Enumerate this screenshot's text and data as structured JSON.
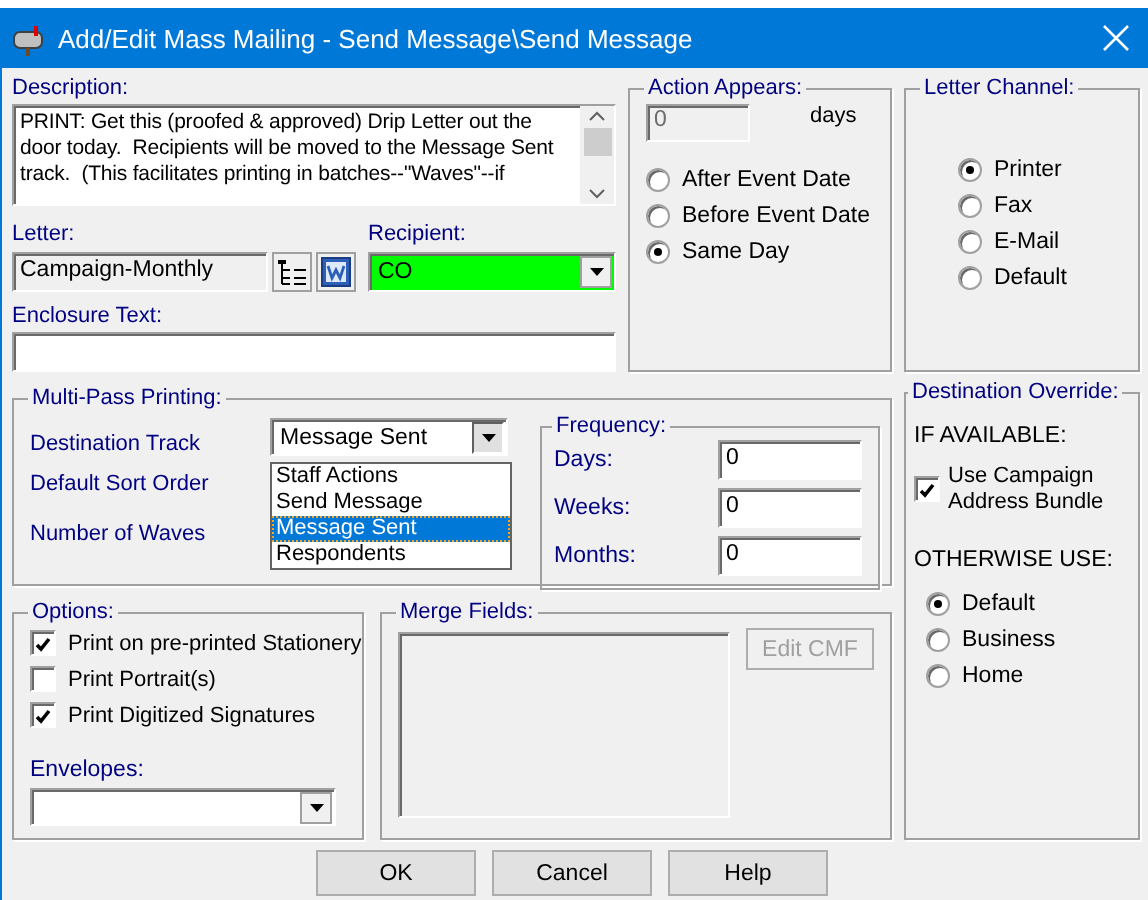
{
  "window": {
    "title": "Add/Edit Mass Mailing - Send Message\\Send Message"
  },
  "description": {
    "label": "Description:",
    "value": "PRINT: Get this (proofed & approved) Drip Letter out the door today.  Recipients will be moved to the Message Sent track.  (This facilitates printing in batches--\"Waves\"--if"
  },
  "letter": {
    "label": "Letter:",
    "value": "Campaign-Monthly"
  },
  "recipient": {
    "label": "Recipient:",
    "value": "CO"
  },
  "enclosure": {
    "label": "Enclosure Text:"
  },
  "action_appears": {
    "title": "Action Appears:",
    "days_value": "0",
    "days_disabled": true,
    "days_label": "days",
    "options": [
      {
        "label": "After Event Date",
        "selected": false
      },
      {
        "label": "Before Event Date",
        "selected": false
      },
      {
        "label": "Same Day",
        "selected": true
      }
    ]
  },
  "letter_channel": {
    "title": "Letter Channel:",
    "options": [
      {
        "label": "Printer",
        "selected": true
      },
      {
        "label": "Fax",
        "selected": false
      },
      {
        "label": "E-Mail",
        "selected": false
      },
      {
        "label": "Default",
        "selected": false
      }
    ]
  },
  "multi_pass": {
    "title": "Multi-Pass Printing:",
    "labels": [
      "Destination Track",
      "Default Sort Order",
      "Number of Waves"
    ],
    "destination_track": {
      "value": "Message Sent",
      "expanded": true,
      "options": [
        {
          "label": "Staff Actions",
          "selected": false
        },
        {
          "label": "Send Message",
          "selected": false
        },
        {
          "label": "Message Sent",
          "selected": true
        },
        {
          "label": "Respondents",
          "selected": false
        }
      ]
    },
    "frequency": {
      "title": "Frequency:",
      "fields": [
        {
          "label": "Days:",
          "value": "0"
        },
        {
          "label": "Weeks:",
          "value": "0"
        },
        {
          "label": "Months:",
          "value": "0"
        }
      ]
    }
  },
  "options": {
    "title": "Options:",
    "checks": [
      {
        "label": "Print on pre-printed Stationery",
        "checked": true
      },
      {
        "label": "Print Portrait(s)",
        "checked": false
      },
      {
        "label": "Print Digitized Signatures",
        "checked": true
      }
    ],
    "envelopes_label": "Envelopes:"
  },
  "merge_fields": {
    "title": "Merge Fields:",
    "button": {
      "label": "Edit CMF",
      "disabled": true
    }
  },
  "destination_override": {
    "title": "Destination Override:",
    "if_available": "IF AVAILABLE:",
    "bundle": {
      "label": "Use Campaign Address Bundle",
      "checked": true
    },
    "otherwise": "OTHERWISE USE:",
    "options": [
      {
        "label": "Default",
        "selected": true
      },
      {
        "label": "Business",
        "selected": false
      },
      {
        "label": "Home",
        "selected": false
      }
    ]
  },
  "buttons": [
    {
      "label": "OK"
    },
    {
      "label": "Cancel"
    },
    {
      "label": "Help"
    }
  ]
}
